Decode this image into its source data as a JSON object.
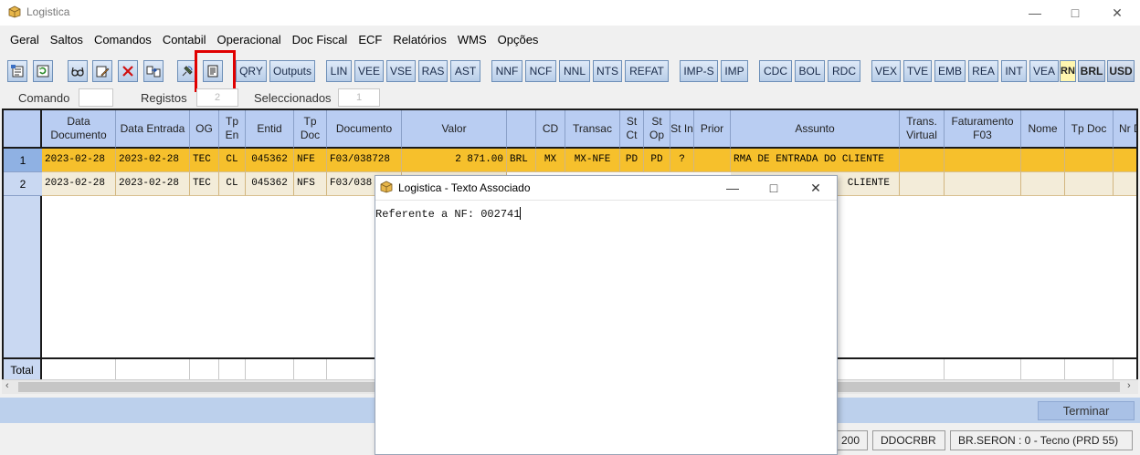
{
  "window": {
    "title": "Logistica"
  },
  "menu": [
    "Geral",
    "Saltos",
    "Comandos",
    "Contabil",
    "Operacional",
    "Doc Fiscal",
    "ECF",
    "Relatórios",
    "WMS",
    "Opções"
  ],
  "toolbar": {
    "icon_buttons": [
      "open-list-icon",
      "refresh-icon",
      "glasses-icon",
      "edit-doc-icon",
      "delete-icon",
      "transfer-icon",
      "satellite-icon",
      "text-doc-icon"
    ],
    "text_buttons": [
      "QRY",
      "Outputs",
      "LIN",
      "VEE",
      "VSE",
      "RAS",
      "AST",
      "NNF",
      "NCF",
      "NNL",
      "NTS",
      "REFAT",
      "IMP-S",
      "IMP",
      "CDC",
      "BOL",
      "RDC",
      "VEX",
      "TVE",
      "EMB",
      "REA",
      "INT",
      "VEA",
      "RN",
      "BRL",
      "USD"
    ]
  },
  "command_row": {
    "comando_label": "Comando",
    "comando_value": "",
    "registos_label": "Registos",
    "registos_value": "2",
    "seleccionados_label": "Seleccionados",
    "seleccionados_value": "1"
  },
  "grid": {
    "headers": [
      "Data Documento",
      "Data Entrada",
      "OG",
      "Tp En",
      "Entid",
      "Tp Doc",
      "Documento",
      "Valor",
      "",
      "CD",
      "Transac",
      "St Ct",
      "St Op",
      "St In",
      "Prior",
      "Assunto",
      "Trans. Virtual",
      "Faturamento F03",
      "Nome",
      "Tp Doc",
      "Nr D"
    ],
    "rows": [
      {
        "num": "1",
        "cells": [
          "2023-02-28",
          "2023-02-28",
          "TEC",
          "CL",
          "045362",
          "NFE",
          "F03/038728",
          "2 871.00",
          "BRL",
          "MX",
          "MX-NFE",
          "PD",
          "PD",
          "?",
          "",
          "RMA DE ENTRADA DO CLIENTE",
          "",
          "",
          "",
          "",
          ""
        ]
      },
      {
        "num": "2",
        "cells": [
          "2023-02-28",
          "2023-02-28",
          "TEC",
          "CL",
          "045362",
          "NFS",
          "F03/038",
          "",
          "",
          "",
          "",
          "",
          "",
          "",
          "",
          "CLIENTE",
          "",
          "",
          "",
          "",
          ""
        ]
      }
    ],
    "total_label": "Total"
  },
  "actions": {
    "terminar": "Terminar"
  },
  "status": [
    "200",
    "DDOCRBR",
    "BR.SERON : 0 - Tecno (PRD 55)"
  ],
  "dialog": {
    "title": "Logistica - Texto Associado",
    "text": "Referente a NF: 002741"
  },
  "colors": {
    "selected_row": "#f6c02c",
    "header": "#b9cdf2",
    "highlight": "#e00000"
  }
}
